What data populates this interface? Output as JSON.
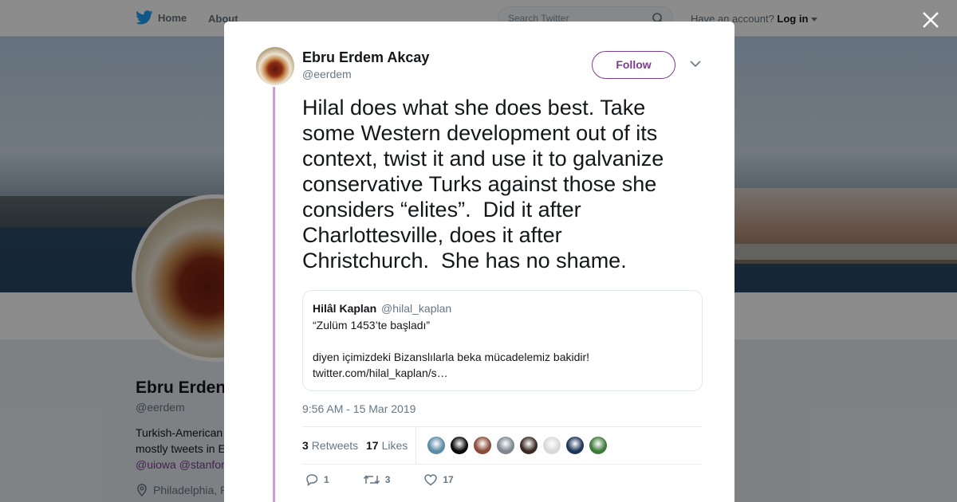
{
  "nav": {
    "home": "Home",
    "about": "About",
    "search_placeholder": "Search Twitter",
    "account_prompt": "Have an account?",
    "login": "Log in"
  },
  "profile": {
    "name": "Ebru Erden",
    "handle": "@eerdem",
    "bio_line1": "Turkish-American",
    "bio_line2": "mostly tweets in E",
    "links": "@uiowa @stanfor",
    "location": "Philadelphia, P"
  },
  "tweet": {
    "author_name": "Ebru Erdem Akcay",
    "author_handle": "@eerdem",
    "follow_label": "Follow",
    "text_lines": [
      "Hilal does what she does best. Take",
      "some Western development out of its",
      "context, twist it and use it to galvanize",
      "conservative Turks against those she",
      "considers “elites”.  Did it after",
      "Charlottesville, does it after",
      "Christchurch.  She has no shame."
    ],
    "quote": {
      "name": "Hilâl Kaplan",
      "handle": "@hilal_kaplan",
      "line1": "“Zulüm 1453’te başladı”",
      "line2": "diyen içimizdeki Bizanslılarla beka mücadelemiz bakidir!",
      "line3": "twitter.com/hilal_kaplan/s…"
    },
    "timestamp": "9:56 AM - 15 Mar 2019",
    "retweets_count": "3",
    "retweets_label": "Retweets",
    "likes_count": "17",
    "likes_label": "Likes",
    "liker_colors": [
      "#5b8aa6",
      "#0a0a0a",
      "#8a4b3a",
      "#7d8790",
      "#3a2a24",
      "#d8d8d8",
      "#1d3558",
      "#3e7a3a"
    ],
    "actions": {
      "replies": "1",
      "retweets": "3",
      "likes": "17"
    }
  },
  "colors": {
    "accent": "#7b3d93",
    "thread_line": "#c7a2cd",
    "muted": "#657786"
  }
}
